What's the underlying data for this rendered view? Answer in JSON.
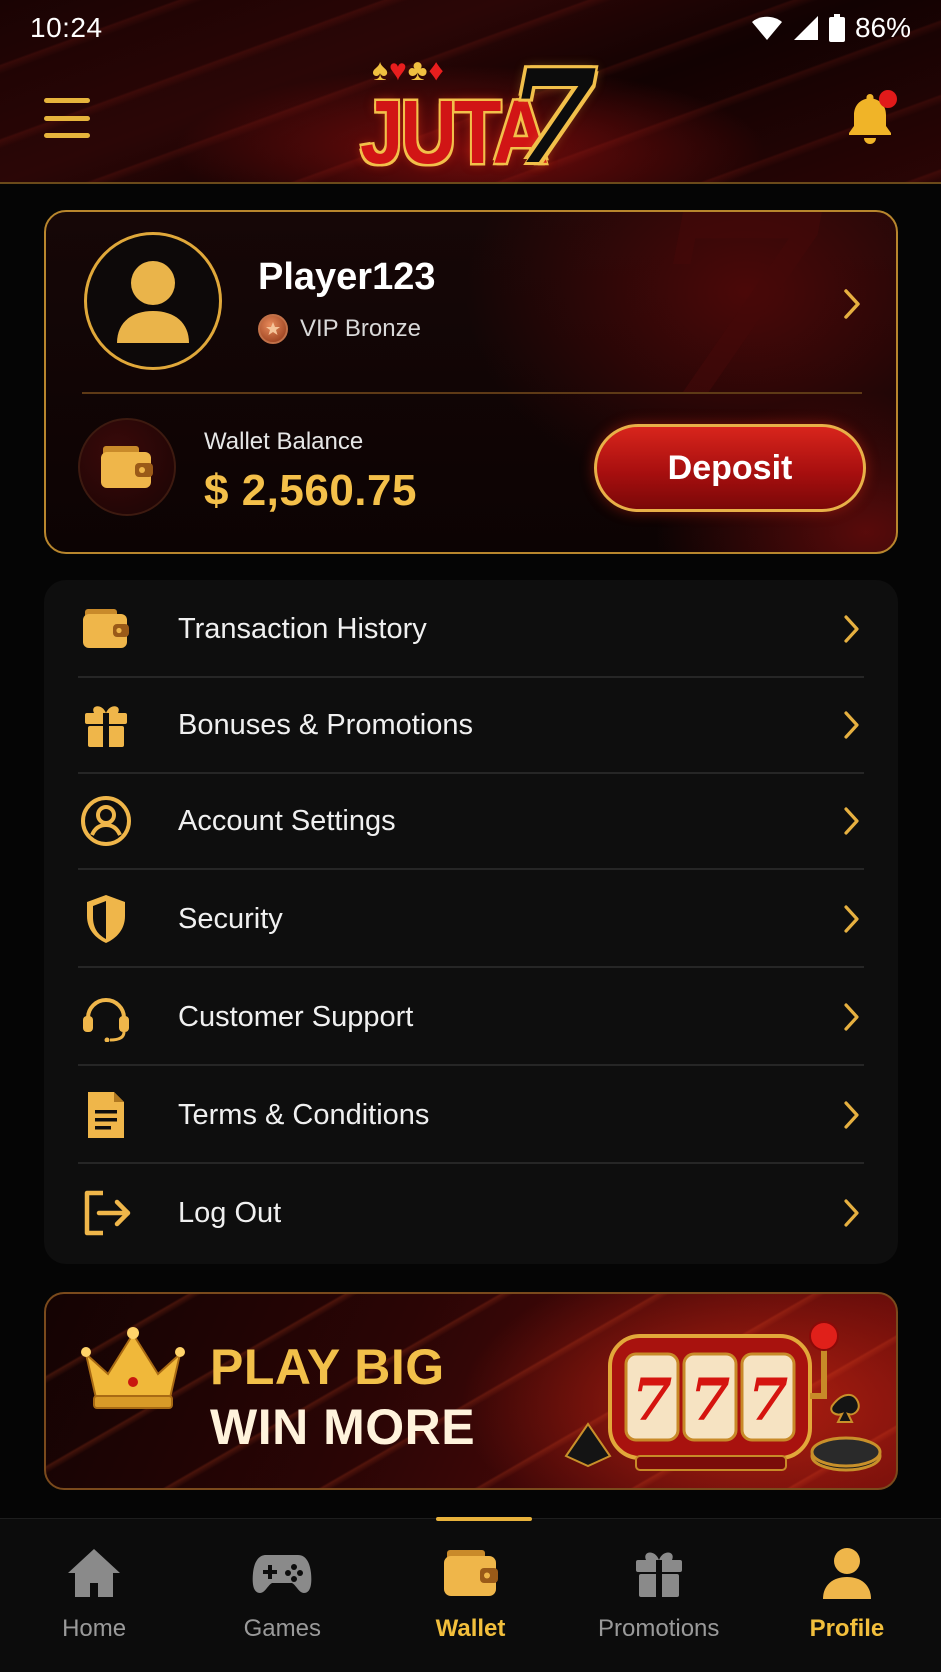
{
  "status_bar": {
    "time": "10:24",
    "battery": "86%"
  },
  "header": {
    "logo_suits": "♠♥♣♦",
    "logo_text": "JUTA",
    "logo_number": "7"
  },
  "profile": {
    "username": "Player123",
    "vip_level": "VIP Bronze",
    "wallet_label": "Wallet Balance",
    "wallet_balance": "$ 2,560.75",
    "deposit_label": "Deposit"
  },
  "menu": {
    "items": [
      {
        "label": "Transaction History",
        "icon": "wallet-icon"
      },
      {
        "label": "Bonuses & Promotions",
        "icon": "gift-icon"
      },
      {
        "label": "Account Settings",
        "icon": "user-circle-icon"
      },
      {
        "label": "Security",
        "icon": "shield-icon"
      },
      {
        "label": "Customer Support",
        "icon": "headset-icon"
      },
      {
        "label": "Terms & Conditions",
        "icon": "document-icon"
      },
      {
        "label": "Log Out",
        "icon": "logout-icon"
      }
    ]
  },
  "promo": {
    "line1": "PLAY BIG",
    "line2": "WIN MORE",
    "slot_symbols": "777"
  },
  "bottom_nav": {
    "items": [
      {
        "label": "Home",
        "icon": "home-icon"
      },
      {
        "label": "Games",
        "icon": "gamepad-icon"
      },
      {
        "label": "Wallet",
        "icon": "wallet-icon"
      },
      {
        "label": "Promotions",
        "icon": "gift-icon"
      },
      {
        "label": "Profile",
        "icon": "profile-icon"
      }
    ],
    "active": "Profile"
  },
  "colors": {
    "accent_gold": "#f2c04a",
    "brand_red": "#c4160f",
    "background": "#050505",
    "inactive": "#9a9a9a"
  }
}
